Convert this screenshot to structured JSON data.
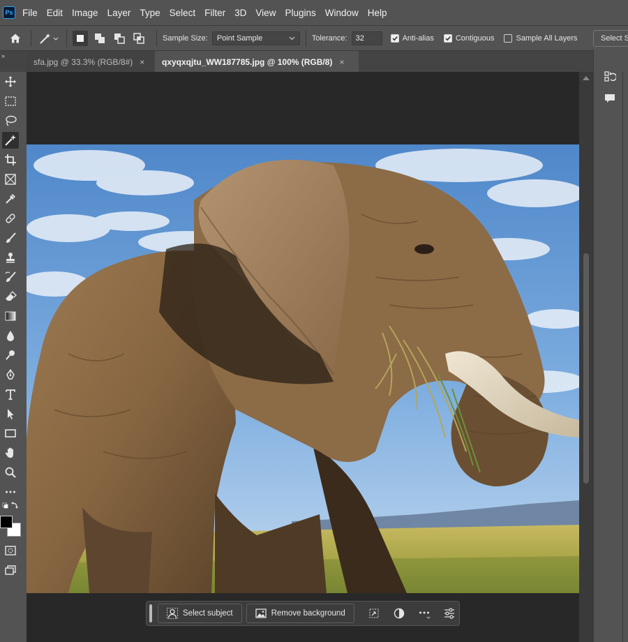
{
  "app": {
    "logo_text": "Ps"
  },
  "menu": [
    "File",
    "Edit",
    "Image",
    "Layer",
    "Type",
    "Select",
    "Filter",
    "3D",
    "View",
    "Plugins",
    "Window",
    "Help"
  ],
  "options": {
    "sample_size_label": "Sample Size:",
    "sample_size_value": "Point Sample",
    "tolerance_label": "Tolerance:",
    "tolerance_value": "32",
    "anti_alias_label": "Anti-alias",
    "anti_alias_checked": true,
    "contiguous_label": "Contiguous",
    "contiguous_checked": true,
    "sample_all_layers_label": "Sample All Layers",
    "sample_all_layers_checked": false,
    "select_subject_label": "Select S"
  },
  "tabs": [
    {
      "label": "sfa.jpg @ 33.3% (RGB/8#)",
      "close": "×",
      "active": false
    },
    {
      "label": "qxyqxqjtu_WW187785.jpg @ 100% (RGB/8)",
      "close": "×",
      "active": true
    }
  ],
  "tools": [
    "move-tool",
    "marquee-tool",
    "lasso-tool",
    "magic-wand-tool",
    "crop-tool",
    "frame-tool",
    "eyedropper-tool",
    "healing-brush-tool",
    "brush-tool",
    "clone-stamp-tool",
    "history-brush-tool",
    "eraser-tool",
    "gradient-tool",
    "blur-tool",
    "dodge-tool",
    "pen-tool",
    "type-tool",
    "path-selection-tool",
    "rectangle-tool",
    "hand-tool",
    "zoom-tool",
    "more-tools"
  ],
  "colors": {
    "foreground": "#000000",
    "background": "#ffffff",
    "accent": "#31a8ff"
  },
  "taskbar": {
    "select_subject": "Select subject",
    "remove_background": "Remove background"
  }
}
